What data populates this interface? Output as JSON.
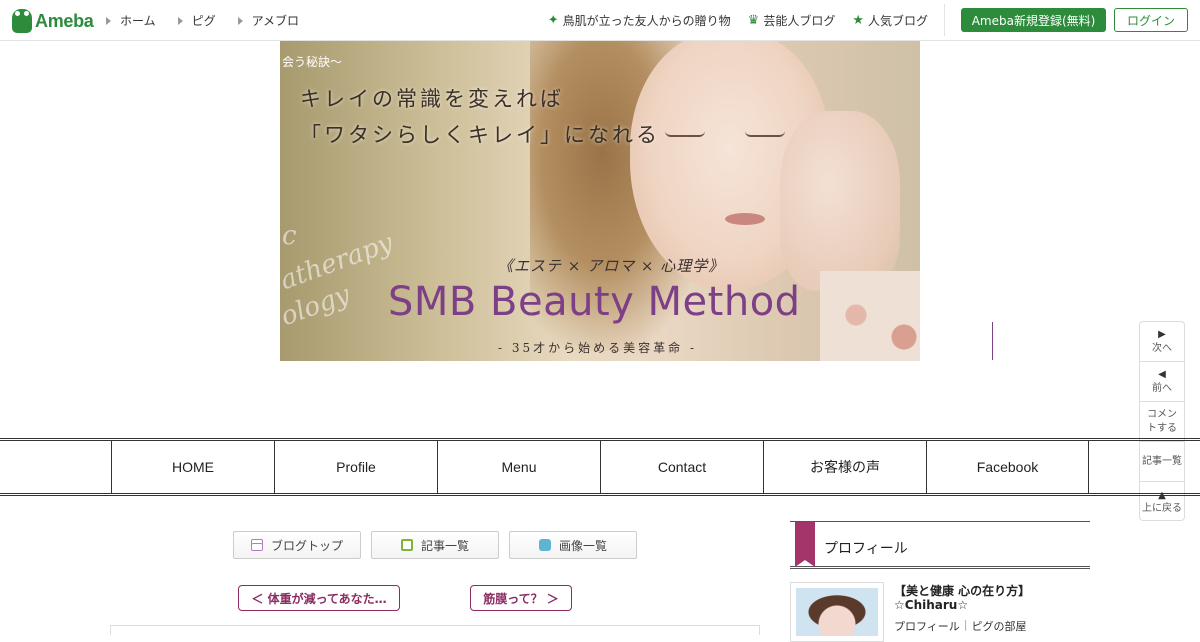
{
  "header": {
    "logo_text": "Ameba",
    "nav_left": [
      "ホーム",
      "ピグ",
      "アメブロ"
    ],
    "nav_right": [
      {
        "icon": "sparkle-icon",
        "label": "鳥肌が立った友人からの贈り物"
      },
      {
        "icon": "crown-icon",
        "label": "芸能人ブログ"
      },
      {
        "icon": "star-icon",
        "label": "人気ブログ"
      }
    ],
    "register_label": "Ameba新規登録(無料)",
    "login_label": "ログイン",
    "brand_color": "#2d8c3c"
  },
  "banner": {
    "small_text": "会う秘訣～",
    "line1": "キレイの常識を変えれば",
    "line2": "「ワタシらしくキレイ」になれる",
    "subtitle": "《エステ × アロマ × 心理学》",
    "title": "SMB Beauty Method",
    "tagline": "- 35才から始める美容革命 -",
    "script_words": [
      "c",
      "atherapy",
      "ology"
    ]
  },
  "side_panel": [
    {
      "icon": "play-right-icon",
      "label": "次へ"
    },
    {
      "icon": "play-left-icon",
      "label": "前へ"
    },
    {
      "icon": "",
      "label": "コメントする"
    },
    {
      "icon": "",
      "label": "記事一覧"
    },
    {
      "icon": "up-triangle-icon",
      "label": "上に戻る"
    }
  ],
  "blog_nav": [
    "HOME",
    "Profile",
    "Menu",
    "Contact",
    "お客様の声",
    "Facebook"
  ],
  "tools": {
    "blog_top": "ブログトップ",
    "entry_list": "記事一覧",
    "image_list": "画像一覧"
  },
  "pager": {
    "prev": "＜ 体重が減ってあなた…",
    "next": "筋膜って？ ＞"
  },
  "profile": {
    "heading": "プロフィール",
    "name_line1": "【美と健康 心の在り方】",
    "name_line2": "☆Chiharu☆",
    "link_profile": "プロフィール",
    "link_room": "ピグの部屋",
    "accent_color": "#a3356b"
  }
}
